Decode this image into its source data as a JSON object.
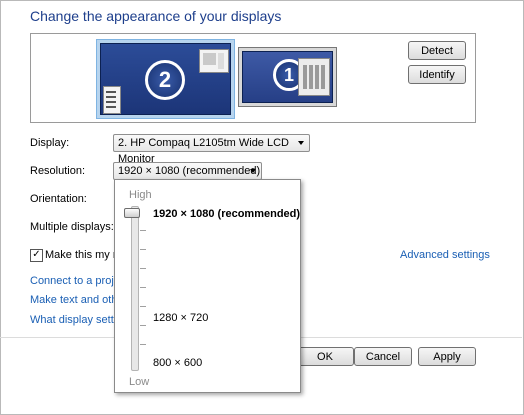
{
  "heading": "Change the appearance of your displays",
  "monitors": [
    {
      "number": "2"
    },
    {
      "number": "1"
    }
  ],
  "buttons": {
    "detect": "Detect",
    "identify": "Identify",
    "ok": "OK",
    "cancel": "Cancel",
    "apply": "Apply"
  },
  "settings": {
    "display_label": "Display:",
    "display_value": "2. HP Compaq L2105tm Wide LCD Monitor",
    "resolution_label": "Resolution:",
    "resolution_value": "1920 × 1080 (recommended)",
    "orientation_label": "Orientation:",
    "multiple_displays_label": "Multiple displays:",
    "main_display_checkbox": "Make this my ma",
    "main_display_checked": true
  },
  "links": {
    "advanced_settings": "Advanced settings",
    "connect_projector": "Connect to a projec",
    "text_size": "Make text and other",
    "what_settings": "What display setting"
  },
  "resolution_slider": {
    "high_label": "High",
    "low_label": "Low",
    "selected": "1920 × 1080 (recommended)",
    "options": [
      "1920 × 1080 (recommended)",
      "1280 × 720",
      "800 × 600"
    ],
    "level": 1.0
  },
  "colors": {
    "heading": "#1e3f8c",
    "link": "#1a5fb4",
    "selected_monitor_border": "#7fb4e2"
  }
}
